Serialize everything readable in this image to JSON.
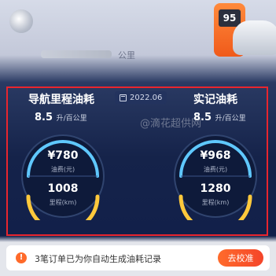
{
  "header": {
    "unit_text": "公里",
    "pump_price": "95"
  },
  "date": "2022.06",
  "watermark": "@滴花超供网",
  "nav_fuel": {
    "title": "导航里程油耗",
    "value": "8.5",
    "unit": "升/百公里",
    "cost": "¥780",
    "cost_label": "油费(元)",
    "mileage": "1008",
    "mileage_label": "里程(km)"
  },
  "actual_fuel": {
    "title": "实记油耗",
    "value": "8.5",
    "unit": "升/百公里",
    "cost": "¥968",
    "cost_label": "油费(元)",
    "mileage": "1280",
    "mileage_label": "里程(km)"
  },
  "notice": {
    "text": "3笔订单已为你自动生成油耗记录",
    "button": "去校准",
    "icon": "bell-icon"
  },
  "colors": {
    "accent": "#f4452a",
    "highlight_border": "#e8252e",
    "gauge_blue": "#5fc8ff",
    "gauge_yellow": "#ffc93c"
  }
}
